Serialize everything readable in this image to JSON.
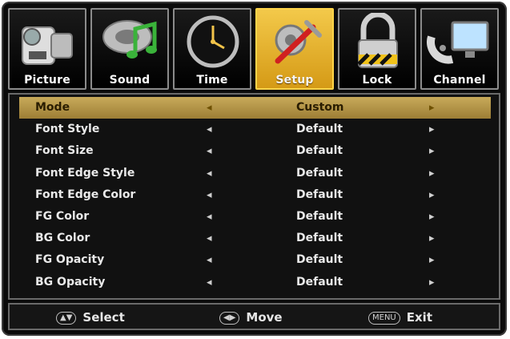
{
  "tabs": [
    {
      "label": "Picture",
      "icon": "camcorder-icon",
      "active": false
    },
    {
      "label": "Sound",
      "icon": "music-speaker-icon",
      "active": false
    },
    {
      "label": "Time",
      "icon": "clock-icon",
      "active": false
    },
    {
      "label": "Setup",
      "icon": "tools-icon",
      "active": true
    },
    {
      "label": "Lock",
      "icon": "padlock-icon",
      "active": false
    },
    {
      "label": "Channel",
      "icon": "satellite-dish-icon",
      "active": false
    }
  ],
  "menu": {
    "items": [
      {
        "label": "Mode",
        "value": "Custom",
        "selected": true
      },
      {
        "label": "Font Style",
        "value": "Default"
      },
      {
        "label": "Font Size",
        "value": "Default"
      },
      {
        "label": "Font Edge Style",
        "value": "Default"
      },
      {
        "label": "Font Edge Color",
        "value": "Default"
      },
      {
        "label": "FG Color",
        "value": "Default"
      },
      {
        "label": "BG Color",
        "value": "Default"
      },
      {
        "label": "FG Opacity",
        "value": "Default"
      },
      {
        "label": "BG Opacity",
        "value": "Default"
      }
    ],
    "left_arrow": "◂",
    "right_arrow": "▸"
  },
  "footer": {
    "select_glyph": "▲▼",
    "select_label": "Select",
    "move_glyph": "◀▶",
    "move_label": "Move",
    "menu_glyph": "MENU",
    "exit_label": "Exit"
  },
  "colors": {
    "active_tab": "#e2ac2a",
    "selected_row": "#b3944a",
    "background": "#0b0b0b"
  }
}
